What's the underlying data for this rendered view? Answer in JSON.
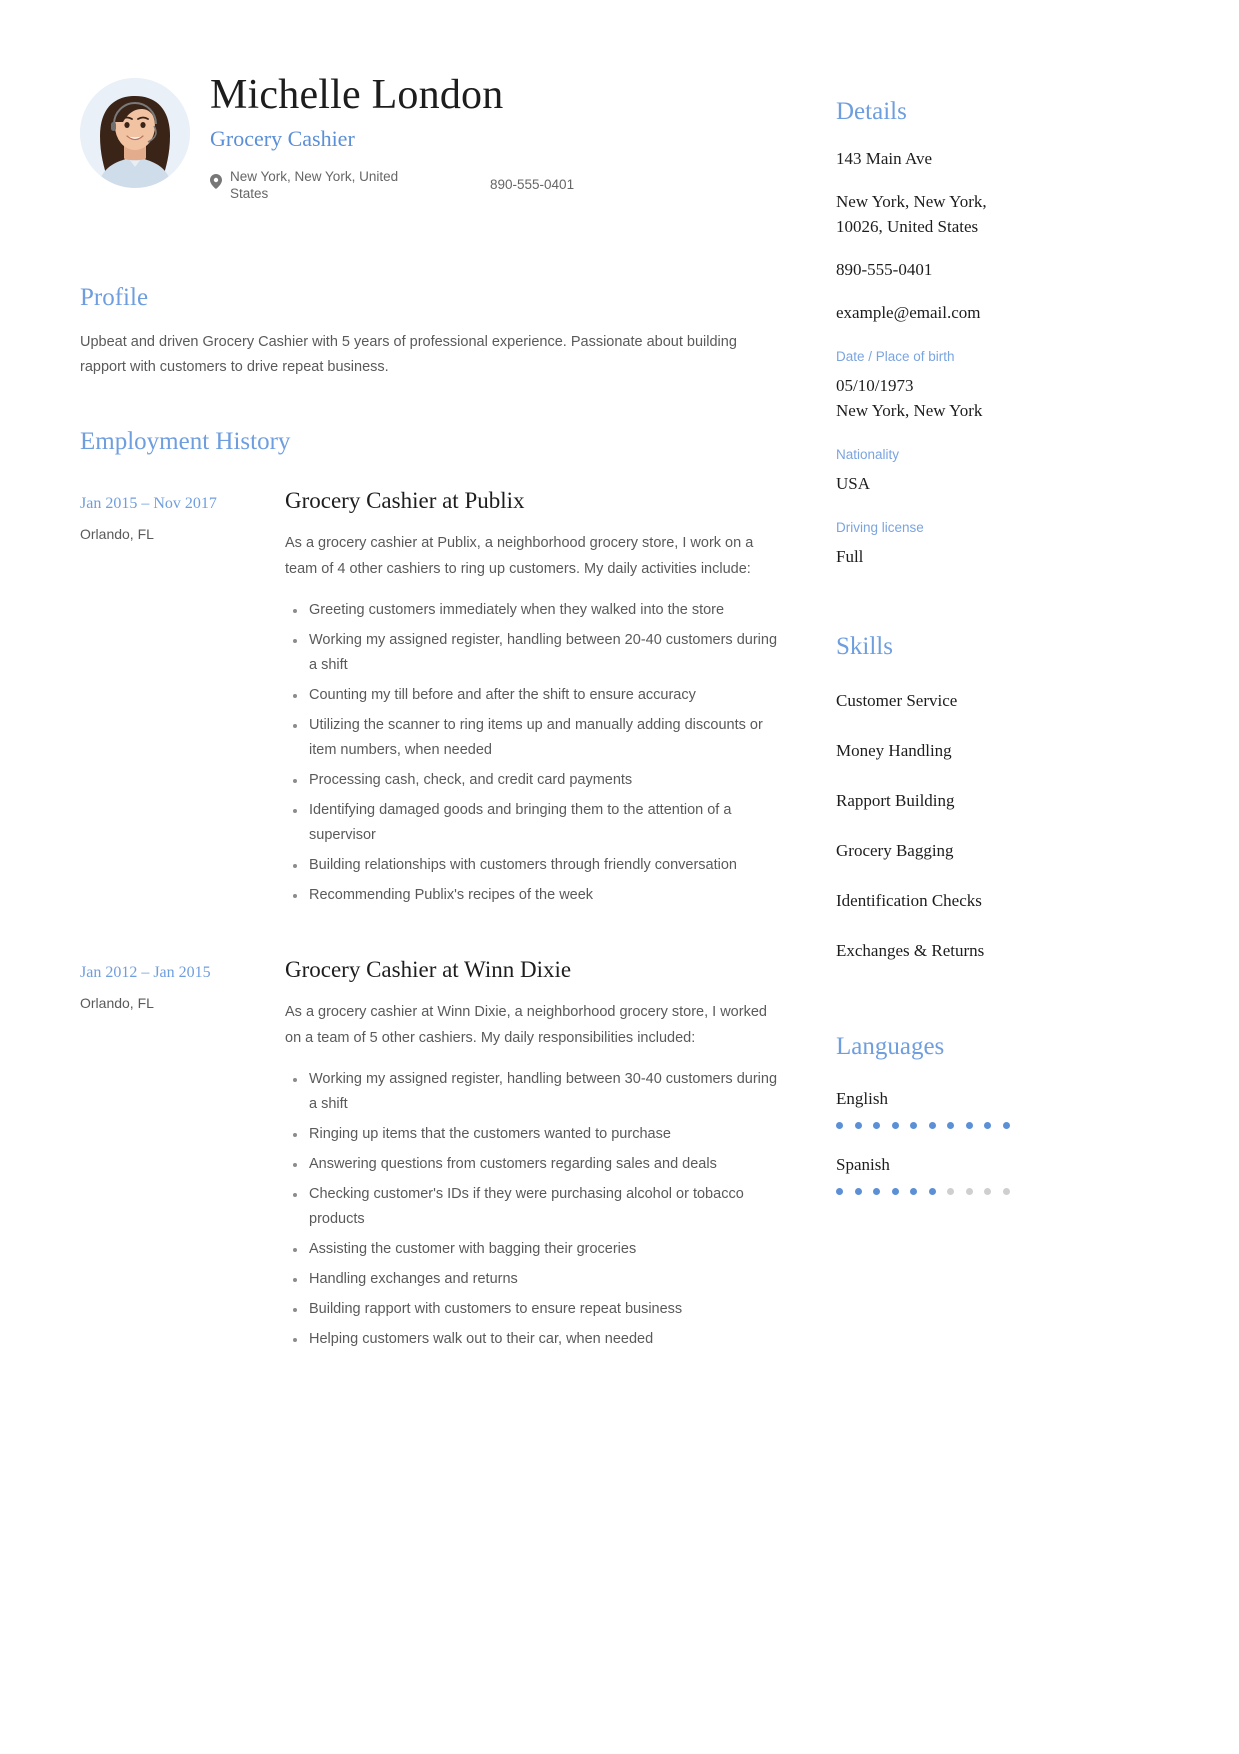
{
  "header": {
    "name": "Michelle London",
    "job_title": "Grocery Cashier",
    "location": "New York, New York, United States",
    "phone": "890-555-0401",
    "location_icon": "map-pin-icon",
    "avatar_alt": "profile-photo"
  },
  "profile": {
    "heading": "Profile",
    "text": "Upbeat and driven Grocery Cashier with 5 years of professional experience. Passionate about building rapport with customers to drive repeat business."
  },
  "employment": {
    "heading": "Employment History",
    "entries": [
      {
        "date": "Jan 2015 – Nov 2017",
        "location": "Orlando, FL",
        "title": "Grocery Cashier at Publix",
        "description": "As a grocery cashier at Publix, a neighborhood grocery store, I work on a team of 4 other cashiers to ring up customers. My daily activities include:",
        "bullets": [
          "Greeting customers immediately when they walked into the store",
          "Working my assigned register, handling between 20-40 customers during a shift",
          "Counting my till before and after the shift to ensure accuracy",
          "Utilizing the scanner to ring items up and manually adding discounts or item numbers, when needed",
          "Processing cash, check, and credit card payments",
          "Identifying damaged goods and bringing them to the attention of a supervisor",
          "Building relationships with customers through friendly conversation",
          "Recommending Publix's recipes of the week"
        ]
      },
      {
        "date": "Jan 2012 – Jan 2015",
        "location": "Orlando, FL",
        "title": "Grocery Cashier at Winn Dixie",
        "description": "As a grocery cashier at Winn Dixie, a neighborhood grocery store, I worked on a team of 5 other cashiers. My daily responsibilities included:",
        "bullets": [
          "Working my assigned register, handling between 30-40 customers during a shift",
          "Ringing up items that the customers wanted to purchase",
          "Answering questions from customers regarding sales and deals",
          "Checking customer's IDs if they were purchasing alcohol or tobacco products",
          "Assisting the customer with bagging their groceries",
          "Handling exchanges and returns",
          "Building rapport with customers to ensure repeat business",
          "Helping customers walk out to their car, when needed"
        ]
      }
    ]
  },
  "details": {
    "heading": "Details",
    "address": "143 Main Ave",
    "city_state_zip": "New York, New York, 10026, United States",
    "phone": "890-555-0401",
    "email": "example@email.com",
    "dob_label": "Date / Place of birth",
    "dob_value": "05/10/1973\nNew York, New York",
    "nationality_label": "Nationality",
    "nationality_value": "USA",
    "license_label": "Driving license",
    "license_value": "Full"
  },
  "skills": {
    "heading": "Skills",
    "items": [
      "Customer Service",
      "Money Handling",
      "Rapport Building",
      "Grocery Bagging",
      "Identification Checks",
      "Exchanges & Returns"
    ]
  },
  "languages": {
    "heading": "Languages",
    "items": [
      {
        "name": "English",
        "level": 10,
        "max": 10
      },
      {
        "name": "Spanish",
        "level": 6,
        "max": 10
      }
    ]
  },
  "colors": {
    "accent": "#6f9ede",
    "accent_title": "#5b8fd6",
    "body_text": "#5a5a5a",
    "heading_text": "#1d1d1d",
    "dot_on": "#5b8fd6",
    "dot_off": "#cfcfcf"
  }
}
